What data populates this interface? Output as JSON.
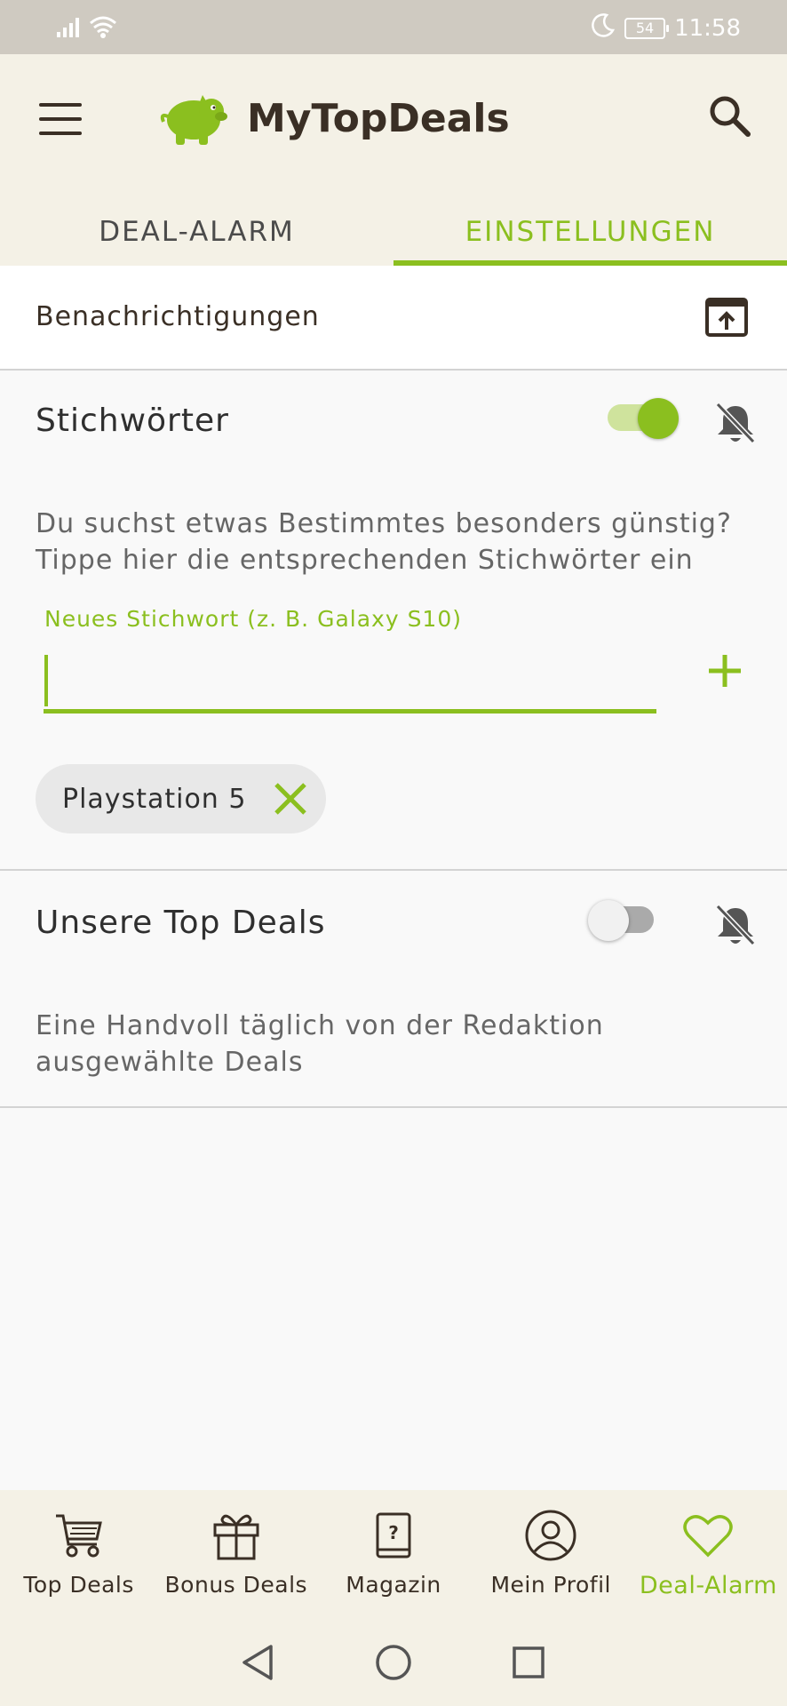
{
  "status_bar": {
    "battery": "54",
    "time": "11:58"
  },
  "app": {
    "title": "MyTopDeals"
  },
  "tabs": [
    {
      "label": "DEAL-ALARM",
      "active": false
    },
    {
      "label": "EINSTELLUNGEN",
      "active": true
    }
  ],
  "notifications": {
    "label": "Benachrichtigungen"
  },
  "keywords": {
    "title": "Stichwörter",
    "enabled": true,
    "description": "Du suchst etwas Bestimmtes besonders günstig? Tippe hier die entsprechenden Stichwörter ein",
    "input_label": "Neues Stichwort (z. B. Galaxy S10)",
    "input_value": "",
    "chips": [
      {
        "label": "Playstation 5"
      }
    ]
  },
  "top_deals": {
    "title": "Unsere Top Deals",
    "enabled": false,
    "description": "Eine Handvoll täglich von der Redaktion ausgewählte Deals"
  },
  "bottom_nav": [
    {
      "label": "Top Deals",
      "icon": "cart-icon"
    },
    {
      "label": "Bonus Deals",
      "icon": "gift-icon"
    },
    {
      "label": "Magazin",
      "icon": "book-question-icon"
    },
    {
      "label": "Mein Profil",
      "icon": "profile-icon"
    },
    {
      "label": "Deal-Alarm",
      "icon": "heart-icon",
      "active": true
    }
  ],
  "colors": {
    "accent": "#8bbf1f",
    "appbar": "#f4f1e6",
    "statusbar": "#cfcac1",
    "text_dark": "#3a2f25"
  }
}
